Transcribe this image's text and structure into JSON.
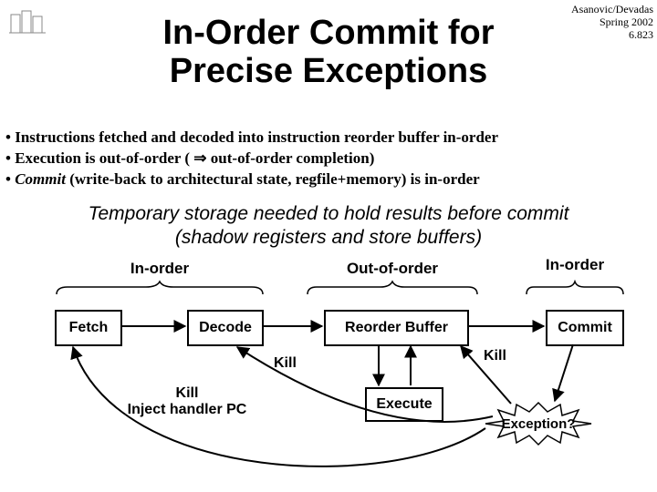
{
  "header": {
    "line1": "Asanovic/Devadas",
    "line2": "Spring 2002",
    "line3": "6.823"
  },
  "title": "In-Order Commit for\nPrecise Exceptions",
  "bullets": {
    "b1": "• Instructions fetched and decoded into instruction reorder buffer in-order",
    "b2": "• Execution is out-of-order ( ⇒ out-of-order completion)",
    "b3_prefix": "• ",
    "b3_em": "Commit",
    "b3_rest": " (write-back to architectural state, regfile+memory) is in-order"
  },
  "tempnote": "Temporary storage needed to hold results before commit\n(shadow registers and store buffers)",
  "stage_labels": {
    "left": "In-order",
    "mid": "Out-of-order",
    "right": "In-order"
  },
  "boxes": {
    "fetch": "Fetch",
    "decode": "Decode",
    "reorder": "Reorder Buffer",
    "execute": "Execute",
    "commit": "Commit"
  },
  "kill": {
    "k1": "Kill",
    "k2": "Kill",
    "inject": "Kill\nInject handler PC"
  },
  "exception": "Exception?"
}
